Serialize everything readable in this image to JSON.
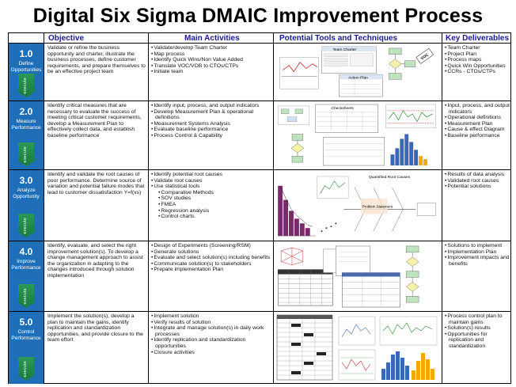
{
  "title": "Digital Six Sigma DMAIC Improvement Process",
  "headers": {
    "objective": "Objective",
    "activities": "Main Activities",
    "tools": "Potential Tools and Techniques",
    "deliverables": "Key Deliverables"
  },
  "execute_label": "execute",
  "phases": [
    {
      "num": "1.0",
      "name": "Define Opportunities",
      "objective": "Validate or refine the business opportunity and charter, illustrate the business processes, define customer requirements, and prepare themselves to be an effective project team",
      "activities": [
        "Validate/develop Team Charter",
        "Map process",
        "Identify Quick Wins/Non Value Added",
        "Translate VOC/VOB to CTOs/CTPs",
        "Initiate team"
      ],
      "deliverables": [
        "Team Charter",
        "Project Plan",
        "Process maps",
        "Quick Win Opportunities",
        "CCRs - CTOs/CTPs"
      ],
      "tool_labels": [
        "Team Charter",
        "Action Plan"
      ]
    },
    {
      "num": "2.0",
      "name": "Measure Performance",
      "objective": "Identify critical measures that are necessary to evaluate the success of meeting critical customer requirements, develop a Measurement Plan to effectively collect data, and establish baseline performance",
      "activities": [
        "Identify input, process, and output indicators",
        "Develop Measurement Plan & operational definitions",
        "Measurement Systems Analysis",
        "Evaluate baseline performance",
        "Process Control & Capability"
      ],
      "deliverables": [
        "Input, process, and output indicators",
        "Operational definitions",
        "Measurement Plan",
        "Cause & effect Diagram",
        "Baseline performance"
      ],
      "tool_labels": [
        "Checksheets"
      ]
    },
    {
      "num": "3.0",
      "name": "Analyze Opportunity",
      "objective": "Identify and validate the root causes of poor performance. Determine source of variation and potential failure modes that lead to customer dissatisfaction    Y=f(xs)",
      "activities": [
        "Identify potential root causes",
        "Validate root causes",
        "Use statistical tools"
      ],
      "activities_sub": [
        "Comparative Methods",
        "SOV studies",
        "FMEA",
        "Regression analysis",
        "Control charts"
      ],
      "deliverables": [
        "Results of data analysis",
        "Validated root causes",
        "Potential solutions"
      ],
      "tool_labels": [
        "Quantified Root Causes",
        "Problem Statement"
      ]
    },
    {
      "num": "4.0",
      "name": "Improve Performance",
      "objective": "Identify, evaluate, and select the right improvement solution(s). To develop a change management approach to assist the organization in adapting to the changes introduced through solution implementation",
      "activities": [
        "Design of Experiments (Screening/RSM)",
        "Generate solutions",
        "Evaluate and select solution(s) including benefits",
        "Communicate solution(s) to stakeholders",
        "Prepare implementation Plan"
      ],
      "deliverables": [
        "Solutions to implement",
        "Implementation Plan",
        "Improvement impacts and benefits"
      ],
      "tool_labels": []
    },
    {
      "num": "5.0",
      "name": "Control Performance",
      "objective": "Implement the solution(s), develop a plan to maintain the gains, identify replication and standardization opportunities, and provide closure to the team effort",
      "activities": [
        "Implement solution",
        "Verify results of solution",
        "Integrate and manage solution(s) in daily work processes",
        "Identify replication and standardization opportunities",
        "Closure activities"
      ],
      "deliverables": [
        "Process control plan to maintain gains",
        "Solution(s) results",
        "Opportunities for replication and standardization"
      ],
      "tool_labels": []
    }
  ]
}
